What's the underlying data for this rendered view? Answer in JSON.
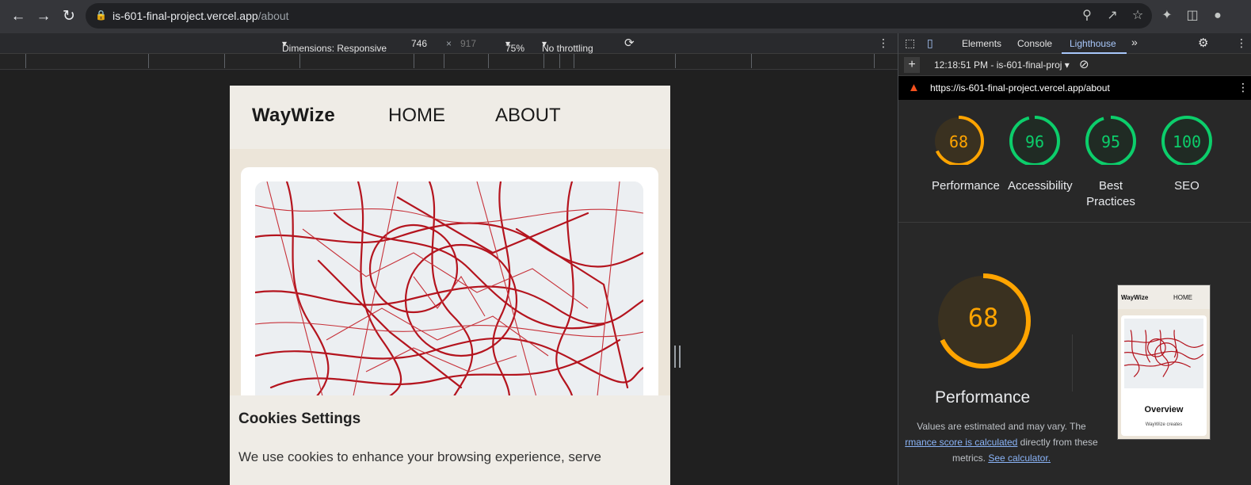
{
  "browser": {
    "url_host": "is-601-final-project.vercel.app",
    "url_path": "/about",
    "back_icon": "arrow-left-icon",
    "forward_icon": "arrow-right-icon",
    "reload_icon": "reload-icon"
  },
  "device_toolbar": {
    "dimensions_label": "Dimensions: Responsive",
    "width": "746",
    "times": "×",
    "height": "917",
    "zoom": "75%",
    "throttling": "No throttling"
  },
  "site": {
    "logo": "WayWize",
    "nav": [
      "HOME",
      "ABOUT"
    ],
    "cookie_title": "Cookies Settings",
    "cookie_text": "We use cookies to enhance your browsing experience, serve"
  },
  "devtools": {
    "tabs": [
      "Elements",
      "Console",
      "Lighthouse"
    ],
    "active_tab": "Lighthouse",
    "report_time": "12:18:51 PM - is-601-final-proj",
    "report_url": "https://is-601-final-project.vercel.app/about",
    "scores": [
      {
        "label": "Performance",
        "value": 68,
        "color": "#ffa400"
      },
      {
        "label": "Accessibility",
        "value": 96,
        "color": "#0cce6b"
      },
      {
        "label": "Best Practices",
        "value": 95,
        "color": "#0cce6b"
      },
      {
        "label": "SEO",
        "value": 100,
        "color": "#0cce6b"
      }
    ],
    "big_score": "68",
    "big_label": "Performance",
    "desc_line1": "Values are estimated and may vary. The",
    "desc_link1": "rmance score is calculated",
    "desc_mid": " directly from these",
    "desc_line3": "metrics. ",
    "desc_link2": "See calculator.",
    "thumb": {
      "logo": "WayWize",
      "nav": "HOME",
      "heading": "Overview",
      "text": "WayWize creates"
    }
  }
}
